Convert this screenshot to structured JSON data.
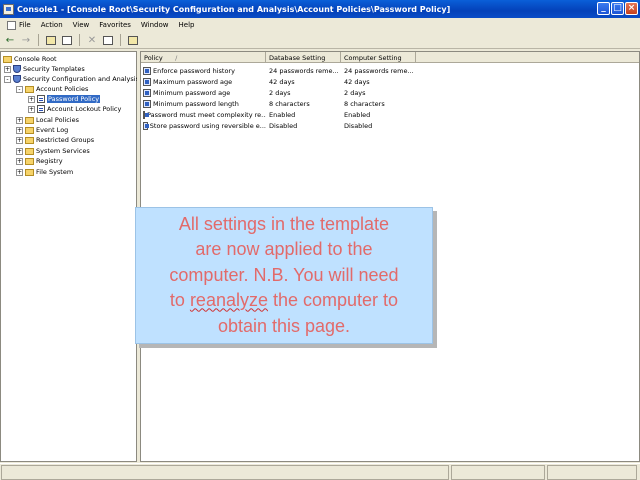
{
  "window": {
    "title": "Console1 - [Console Root\\Security Configuration and Analysis\\Account Policies\\Password Policy]"
  },
  "menu": [
    "File",
    "Action",
    "View",
    "Favorites",
    "Window",
    "Help"
  ],
  "tree": {
    "root": "Console Root",
    "templates": "Security Templates",
    "sca": "Security Configuration and Analysis",
    "account_policies": "Account Policies",
    "password_policy": "Password Policy",
    "lockout_policy": "Account Lockout Policy",
    "local_policies": "Local Policies",
    "event_log": "Event Log",
    "restricted_groups": "Restricted Groups",
    "system_services": "System Services",
    "registry": "Registry",
    "file_system": "File System"
  },
  "list": {
    "headers": [
      "Policy",
      "Database Setting",
      "Computer Setting"
    ],
    "sort_indicator": "/",
    "rows": [
      {
        "policy": "Enforce password history",
        "db": "24 passwords reme...",
        "computer": "24 passwords reme..."
      },
      {
        "policy": "Maximum password age",
        "db": "42 days",
        "computer": "42 days"
      },
      {
        "policy": "Minimum password age",
        "db": "2 days",
        "computer": "2 days"
      },
      {
        "policy": "Minimum password length",
        "db": "8 characters",
        "computer": "8 characters"
      },
      {
        "policy": "Password must meet complexity re...",
        "db": "Enabled",
        "computer": "Enabled"
      },
      {
        "policy": "Store password using reversible e...",
        "db": "Disabled",
        "computer": "Disabled"
      }
    ]
  },
  "callout": {
    "line1": "All settings in the template",
    "line2": "are now applied to the",
    "line3": "computer. N.B. You will need",
    "line4_pre": "to ",
    "line4_word": "reanalyze",
    "line4_post": " the computer to",
    "line5": "obtain this page."
  }
}
